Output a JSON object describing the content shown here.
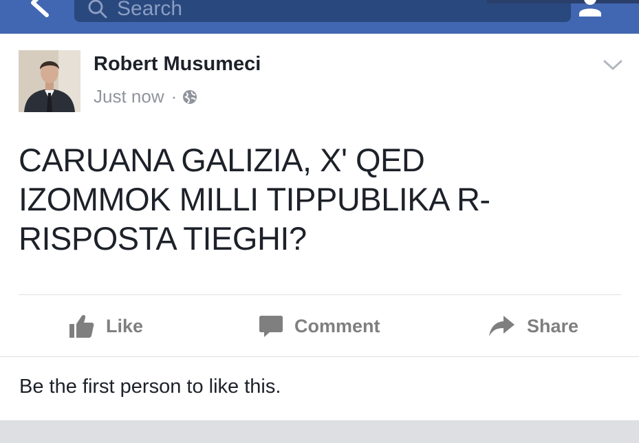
{
  "header": {
    "search_placeholder": "Search"
  },
  "post": {
    "author": "Robert Musumeci",
    "timestamp": "Just now",
    "separator": "·",
    "privacy_icon": "globe-icon",
    "text_lines": [
      "CARUANA GALIZIA, X' QED",
      "IZOMMOK MILLI TIPPUBLIKA R-",
      "RISPOSTA TIEGHI?"
    ]
  },
  "actions": {
    "like_label": "Like",
    "comment_label": "Comment",
    "share_label": "Share"
  },
  "reactions": {
    "summary": "Be the first person to like this."
  },
  "colors": {
    "header_blue": "#4267b2",
    "search_bg": "#29487d",
    "text": "#1d2129",
    "muted": "#90949c",
    "action_gray": "#7f7f7f"
  }
}
